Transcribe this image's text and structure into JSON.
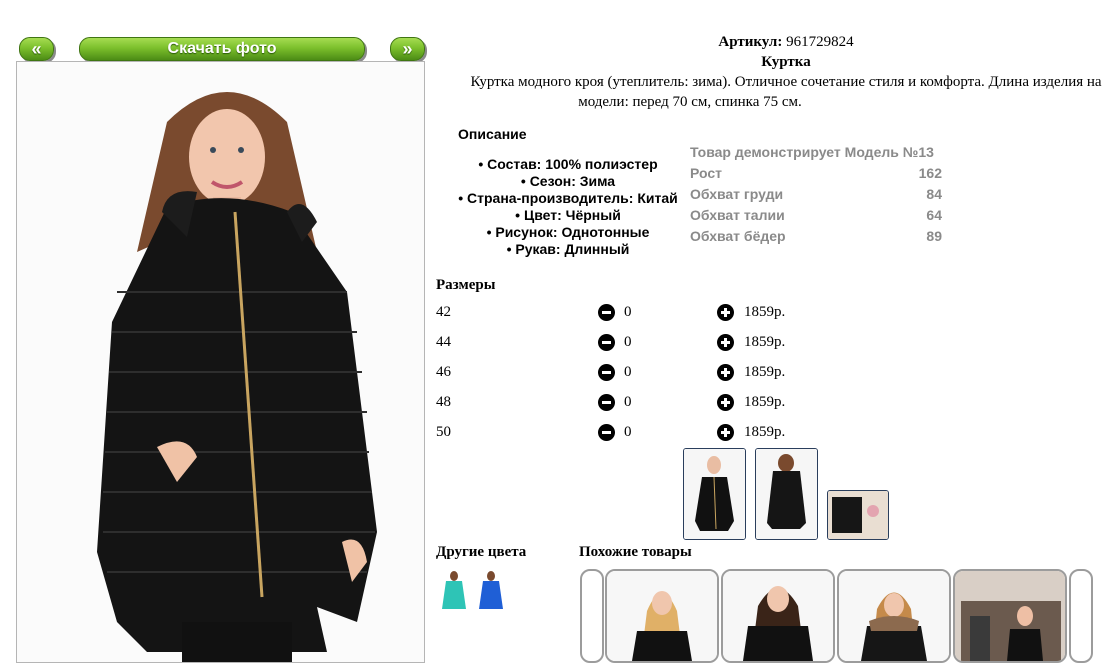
{
  "nav": {
    "prev_label": "«",
    "download_label": "Скачать фото",
    "next_label": "»"
  },
  "product": {
    "article_label": "Артикул:",
    "article_value": "961729824",
    "name": "Куртка",
    "description_line1": "Куртка модного кроя (утеплитель: зима). Отличное сочетание стиля и комфорта. Длина изделия на",
    "description_line2": "модели: перед 70 см, спинка 75 см."
  },
  "description_section": {
    "title": "Описание",
    "properties": [
      "Состав: 100% полиэстер",
      "Сезон: Зима",
      "Страна-производитель: Китай",
      "Цвет: Чёрный",
      "Рисунок: Однотонные",
      "Рукав: Длинный"
    ]
  },
  "model": {
    "title": "Товар демонстрирует Модель №13",
    "rows": [
      {
        "label": "Рост",
        "value": "162"
      },
      {
        "label": "Обхват груди",
        "value": "84"
      },
      {
        "label": "Обхват талии",
        "value": "64"
      },
      {
        "label": "Обхват бёдер",
        "value": "89"
      }
    ]
  },
  "sizes": {
    "title": "Размеры",
    "rows": [
      {
        "size": "42",
        "qty": "0",
        "price": "1859р."
      },
      {
        "size": "44",
        "qty": "0",
        "price": "1859р."
      },
      {
        "size": "46",
        "qty": "0",
        "price": "1859р."
      },
      {
        "size": "48",
        "qty": "0",
        "price": "1859р."
      },
      {
        "size": "50",
        "qty": "0",
        "price": "1859р."
      }
    ],
    "icons": {
      "minus": "minus-circle-icon",
      "plus": "plus-circle-icon"
    }
  },
  "other_colors": {
    "title": "Другие цвета",
    "swatches": [
      {
        "color": "#2ec4b6"
      },
      {
        "color": "#1f5fd6"
      }
    ]
  },
  "similar": {
    "title": "Похожие товары"
  },
  "colors": {
    "button_green": "#7cc02c",
    "model_text": "#8a8a8a",
    "thumb_border": "#2a3e5c"
  }
}
